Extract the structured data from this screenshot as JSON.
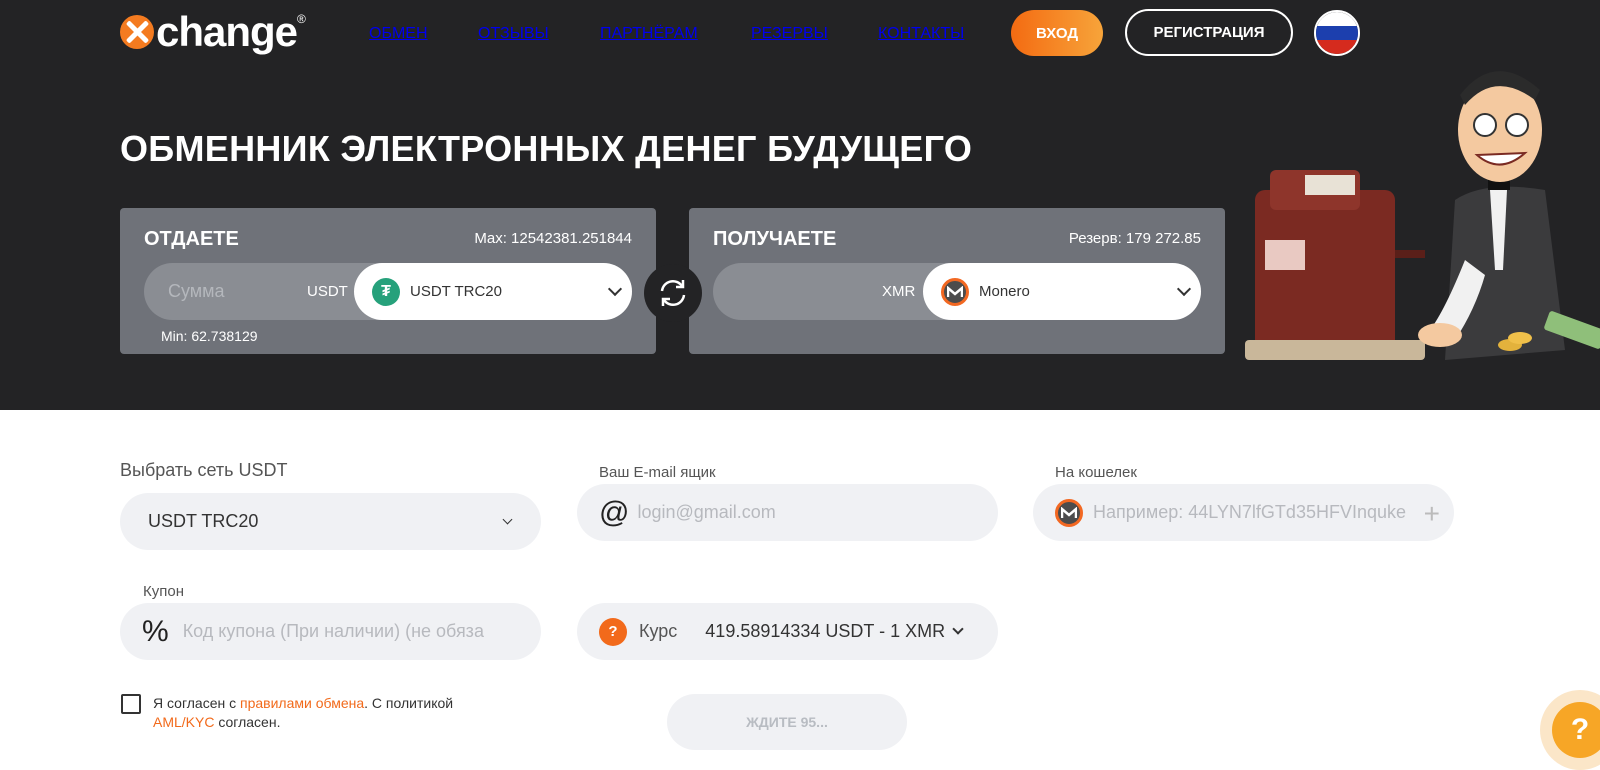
{
  "header": {
    "logo_text": "change",
    "logo_reg": "®",
    "nav": [
      "ОБМЕН",
      "ОТЗЫВЫ",
      "ПАРТНЁРАМ",
      "РЕЗЕРВЫ",
      "КОНТАКТЫ"
    ],
    "login_label": "ВХОД",
    "register_label": "РЕГИСТРАЦИЯ",
    "language_flag": "russia-flag-icon"
  },
  "hero": {
    "title": "ОБМЕННИК ЭЛЕКТРОННЫХ ДЕНЕГ БУДУЩЕГО",
    "give": {
      "label": "ОТДАЕТЕ",
      "max": "Max: 12542381.251844",
      "amount_placeholder": "Сумма",
      "currency_code": "USDT",
      "coin_name": "USDT TRC20",
      "coin_icon": "tether-icon",
      "min": "Min: 62.738129"
    },
    "get": {
      "label": "ПОЛУЧАЕТЕ",
      "reserve": "Резерв: 179 272.85",
      "currency_code": "XMR",
      "coin_name": "Monero",
      "coin_icon": "monero-icon"
    }
  },
  "form": {
    "network_label": "Выбрать сеть USDT",
    "network_value": "USDT TRC20",
    "email_label": "Ваш E-mail ящик",
    "email_placeholder": "login@gmail.com",
    "wallet_label": "На кошелек",
    "wallet_placeholder": "Например: 44LYN7lfGTd35HFVInquke",
    "coupon_label": "Купон",
    "coupon_placeholder": "Код купона (При наличии) (не обяза",
    "rate_label": "Курс",
    "rate_value": "419.58914334 USDT - 1 XMR",
    "agree_prefix": "Я согласен с ",
    "agree_link1": "правилами обмена",
    "agree_middle": ". С политикой",
    "agree_link2": "AML/KYC",
    "agree_suffix": " согласен.",
    "wait_button": "ЖДИТЕ 95..."
  },
  "colors": {
    "accent": "#f26a1b",
    "hero_bg": "#232325",
    "panel_bg": "#6f7279",
    "tether": "#26a17b",
    "monero": "#f26822"
  }
}
